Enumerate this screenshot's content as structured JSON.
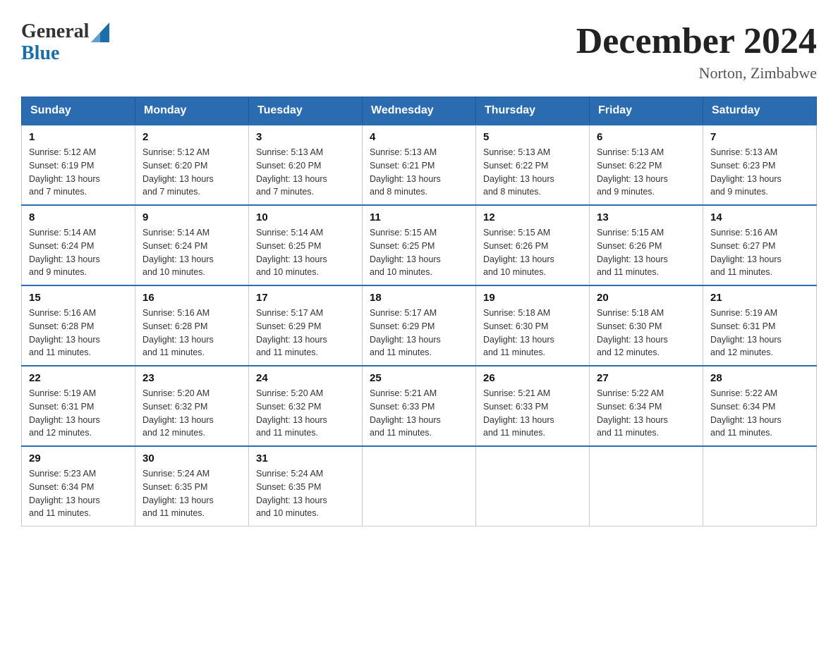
{
  "header": {
    "logo_general": "General",
    "logo_blue": "Blue",
    "title": "December 2024",
    "subtitle": "Norton, Zimbabwe"
  },
  "days_of_week": [
    "Sunday",
    "Monday",
    "Tuesday",
    "Wednesday",
    "Thursday",
    "Friday",
    "Saturday"
  ],
  "weeks": [
    [
      {
        "day": "1",
        "sunrise": "5:12 AM",
        "sunset": "6:19 PM",
        "daylight": "13 hours and 7 minutes."
      },
      {
        "day": "2",
        "sunrise": "5:12 AM",
        "sunset": "6:20 PM",
        "daylight": "13 hours and 7 minutes."
      },
      {
        "day": "3",
        "sunrise": "5:13 AM",
        "sunset": "6:20 PM",
        "daylight": "13 hours and 7 minutes."
      },
      {
        "day": "4",
        "sunrise": "5:13 AM",
        "sunset": "6:21 PM",
        "daylight": "13 hours and 8 minutes."
      },
      {
        "day": "5",
        "sunrise": "5:13 AM",
        "sunset": "6:22 PM",
        "daylight": "13 hours and 8 minutes."
      },
      {
        "day": "6",
        "sunrise": "5:13 AM",
        "sunset": "6:22 PM",
        "daylight": "13 hours and 9 minutes."
      },
      {
        "day": "7",
        "sunrise": "5:13 AM",
        "sunset": "6:23 PM",
        "daylight": "13 hours and 9 minutes."
      }
    ],
    [
      {
        "day": "8",
        "sunrise": "5:14 AM",
        "sunset": "6:24 PM",
        "daylight": "13 hours and 9 minutes."
      },
      {
        "day": "9",
        "sunrise": "5:14 AM",
        "sunset": "6:24 PM",
        "daylight": "13 hours and 10 minutes."
      },
      {
        "day": "10",
        "sunrise": "5:14 AM",
        "sunset": "6:25 PM",
        "daylight": "13 hours and 10 minutes."
      },
      {
        "day": "11",
        "sunrise": "5:15 AM",
        "sunset": "6:25 PM",
        "daylight": "13 hours and 10 minutes."
      },
      {
        "day": "12",
        "sunrise": "5:15 AM",
        "sunset": "6:26 PM",
        "daylight": "13 hours and 10 minutes."
      },
      {
        "day": "13",
        "sunrise": "5:15 AM",
        "sunset": "6:26 PM",
        "daylight": "13 hours and 11 minutes."
      },
      {
        "day": "14",
        "sunrise": "5:16 AM",
        "sunset": "6:27 PM",
        "daylight": "13 hours and 11 minutes."
      }
    ],
    [
      {
        "day": "15",
        "sunrise": "5:16 AM",
        "sunset": "6:28 PM",
        "daylight": "13 hours and 11 minutes."
      },
      {
        "day": "16",
        "sunrise": "5:16 AM",
        "sunset": "6:28 PM",
        "daylight": "13 hours and 11 minutes."
      },
      {
        "day": "17",
        "sunrise": "5:17 AM",
        "sunset": "6:29 PM",
        "daylight": "13 hours and 11 minutes."
      },
      {
        "day": "18",
        "sunrise": "5:17 AM",
        "sunset": "6:29 PM",
        "daylight": "13 hours and 11 minutes."
      },
      {
        "day": "19",
        "sunrise": "5:18 AM",
        "sunset": "6:30 PM",
        "daylight": "13 hours and 11 minutes."
      },
      {
        "day": "20",
        "sunrise": "5:18 AM",
        "sunset": "6:30 PM",
        "daylight": "13 hours and 12 minutes."
      },
      {
        "day": "21",
        "sunrise": "5:19 AM",
        "sunset": "6:31 PM",
        "daylight": "13 hours and 12 minutes."
      }
    ],
    [
      {
        "day": "22",
        "sunrise": "5:19 AM",
        "sunset": "6:31 PM",
        "daylight": "13 hours and 12 minutes."
      },
      {
        "day": "23",
        "sunrise": "5:20 AM",
        "sunset": "6:32 PM",
        "daylight": "13 hours and 12 minutes."
      },
      {
        "day": "24",
        "sunrise": "5:20 AM",
        "sunset": "6:32 PM",
        "daylight": "13 hours and 11 minutes."
      },
      {
        "day": "25",
        "sunrise": "5:21 AM",
        "sunset": "6:33 PM",
        "daylight": "13 hours and 11 minutes."
      },
      {
        "day": "26",
        "sunrise": "5:21 AM",
        "sunset": "6:33 PM",
        "daylight": "13 hours and 11 minutes."
      },
      {
        "day": "27",
        "sunrise": "5:22 AM",
        "sunset": "6:34 PM",
        "daylight": "13 hours and 11 minutes."
      },
      {
        "day": "28",
        "sunrise": "5:22 AM",
        "sunset": "6:34 PM",
        "daylight": "13 hours and 11 minutes."
      }
    ],
    [
      {
        "day": "29",
        "sunrise": "5:23 AM",
        "sunset": "6:34 PM",
        "daylight": "13 hours and 11 minutes."
      },
      {
        "day": "30",
        "sunrise": "5:24 AM",
        "sunset": "6:35 PM",
        "daylight": "13 hours and 11 minutes."
      },
      {
        "day": "31",
        "sunrise": "5:24 AM",
        "sunset": "6:35 PM",
        "daylight": "13 hours and 10 minutes."
      },
      null,
      null,
      null,
      null
    ]
  ],
  "labels": {
    "sunrise": "Sunrise:",
    "sunset": "Sunset:",
    "daylight": "Daylight:"
  }
}
